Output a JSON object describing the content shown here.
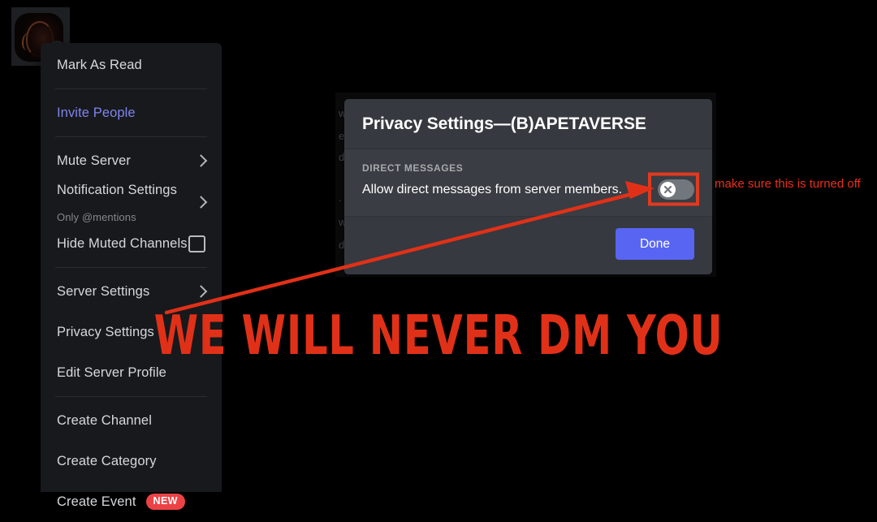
{
  "avatar": {
    "name": "server-avatar",
    "has_notification_badge": true
  },
  "context_menu": {
    "items": [
      {
        "label": "Mark As Read",
        "type": "item"
      },
      {
        "type": "separator"
      },
      {
        "label": "Invite People",
        "type": "item",
        "style": "highlight"
      },
      {
        "type": "separator"
      },
      {
        "label": "Mute Server",
        "type": "submenu"
      },
      {
        "label": "Notification Settings",
        "sublabel": "Only @mentions",
        "type": "submenu"
      },
      {
        "label": "Hide Muted Channels",
        "type": "checkbox",
        "checked": false
      },
      {
        "type": "separator"
      },
      {
        "label": "Server Settings",
        "type": "submenu"
      },
      {
        "label": "Privacy Settings",
        "type": "item"
      },
      {
        "label": "Edit Server Profile",
        "type": "item"
      },
      {
        "type": "separator"
      },
      {
        "label": "Create Channel",
        "type": "item"
      },
      {
        "label": "Create Category",
        "type": "item"
      },
      {
        "label": "Create Event",
        "type": "item",
        "badge": "NEW"
      }
    ]
  },
  "modal": {
    "title": "Privacy Settings—(B)APETAVERSE",
    "section_label": "DIRECT MESSAGES",
    "section_text": "Allow direct messages from server members.",
    "toggle": {
      "name": "allow-dms-toggle",
      "state": "off",
      "glyph": "x-mark-icon"
    },
    "done_label": "Done"
  },
  "background_ghost_text": [
    "w",
    "ed",
    "d",
    ".",
    "w",
    "d"
  ],
  "annotations": {
    "note": "make sure this is turned off",
    "headline": "WE WILL NEVER DM YOU",
    "arrow": "red-arrow-pointing-to-toggle"
  },
  "colors": {
    "page_background": "#000000",
    "menu_background": "#18191c",
    "modal_background": "#36393f",
    "modal_body_background": "#3a3d43",
    "accent_blurple": "#5865f2",
    "invite_link": "#7f84ef",
    "annotation_red": "#e03118",
    "badge_red": "#ed4245",
    "toggle_off_track": "#72767d"
  }
}
